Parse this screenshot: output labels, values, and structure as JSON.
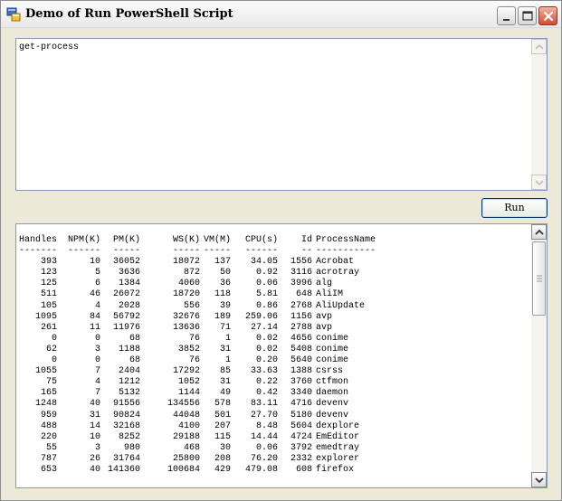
{
  "window": {
    "title": "Demo of Run PowerShell Script",
    "icon": "app-icon",
    "controls": [
      "minimize-icon",
      "maximize-icon",
      "close-icon"
    ]
  },
  "script_input": {
    "value": "get-process"
  },
  "run_button": {
    "label": "Run"
  },
  "output": {
    "columns": [
      "Handles",
      "NPM(K)",
      "PM(K)",
      "WS(K)",
      "VM(M)",
      "CPU(s)",
      "Id",
      "ProcessName"
    ],
    "separators": [
      "-------",
      "------",
      "-----",
      "-----",
      "-----",
      "------",
      "--",
      "-----------"
    ],
    "rows": [
      [
        "393",
        "10",
        "36052",
        "18072",
        "137",
        "34.05",
        "1556",
        "Acrobat"
      ],
      [
        "123",
        "5",
        "3636",
        "872",
        "50",
        "0.92",
        "3116",
        "acrotray"
      ],
      [
        "125",
        "6",
        "1384",
        "4060",
        "36",
        "0.06",
        "3996",
        "alg"
      ],
      [
        "511",
        "46",
        "26072",
        "18720",
        "118",
        "5.81",
        "648",
        "AliIM"
      ],
      [
        "105",
        "4",
        "2028",
        "556",
        "39",
        "0.86",
        "2768",
        "AliUpdate"
      ],
      [
        "1095",
        "84",
        "56792",
        "32676",
        "189",
        "259.06",
        "1156",
        "avp"
      ],
      [
        "261",
        "11",
        "11976",
        "13636",
        "71",
        "27.14",
        "2788",
        "avp"
      ],
      [
        "0",
        "0",
        "68",
        "76",
        "1",
        "0.02",
        "4656",
        "conime"
      ],
      [
        "62",
        "3",
        "1188",
        "3852",
        "31",
        "0.02",
        "5408",
        "conime"
      ],
      [
        "0",
        "0",
        "68",
        "76",
        "1",
        "0.20",
        "5640",
        "conime"
      ],
      [
        "1055",
        "7",
        "2404",
        "17292",
        "85",
        "33.63",
        "1388",
        "csrss"
      ],
      [
        "75",
        "4",
        "1212",
        "1052",
        "31",
        "0.22",
        "3760",
        "ctfmon"
      ],
      [
        "165",
        "7",
        "5132",
        "1144",
        "49",
        "0.42",
        "3340",
        "daemon"
      ],
      [
        "1248",
        "40",
        "91556",
        "134556",
        "578",
        "83.11",
        "4716",
        "devenv"
      ],
      [
        "959",
        "31",
        "90824",
        "44048",
        "501",
        "27.70",
        "5180",
        "devenv"
      ],
      [
        "488",
        "14",
        "32168",
        "4100",
        "207",
        "8.48",
        "5604",
        "dexplore"
      ],
      [
        "220",
        "10",
        "8252",
        "29188",
        "115",
        "14.44",
        "4724",
        "EmEditor"
      ],
      [
        "55",
        "3",
        "980",
        "468",
        "30",
        "0.06",
        "3792",
        "emedtray"
      ],
      [
        "787",
        "26",
        "31764",
        "25800",
        "208",
        "76.20",
        "2332",
        "explorer"
      ],
      [
        "653",
        "40",
        "141360",
        "100684",
        "429",
        "479.08",
        "608",
        "firefox"
      ]
    ]
  },
  "colors": {
    "window_bg": "#ece9d8",
    "textbox_border": "#7f9db9",
    "button_border": "#003c74",
    "close_button": "#d64a2c"
  }
}
